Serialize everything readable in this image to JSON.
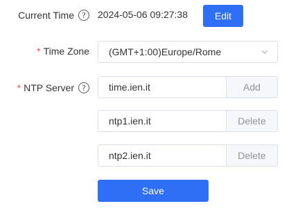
{
  "current_time": {
    "label": "Current Time",
    "help_icon": "help-icon",
    "value": "2024-05-06 09:27:38",
    "edit_label": "Edit"
  },
  "time_zone": {
    "required_mark": "*",
    "label": "Time Zone",
    "selected": "(GMT+1:00)Europe/Rome"
  },
  "ntp": {
    "required_mark": "*",
    "label": "NTP Server",
    "help_icon": "help-icon",
    "servers": [
      {
        "value": "time.ien.it",
        "action": "Add"
      },
      {
        "value": "ntp1.ien.it",
        "action": "Delete"
      },
      {
        "value": "ntp2.ien.it",
        "action": "Delete"
      }
    ]
  },
  "save_label": "Save",
  "colors": {
    "primary": "#2f6ff6",
    "required": "#ff4d4f",
    "border": "#dcdfe6",
    "addon_bg": "#f5f7fa"
  }
}
